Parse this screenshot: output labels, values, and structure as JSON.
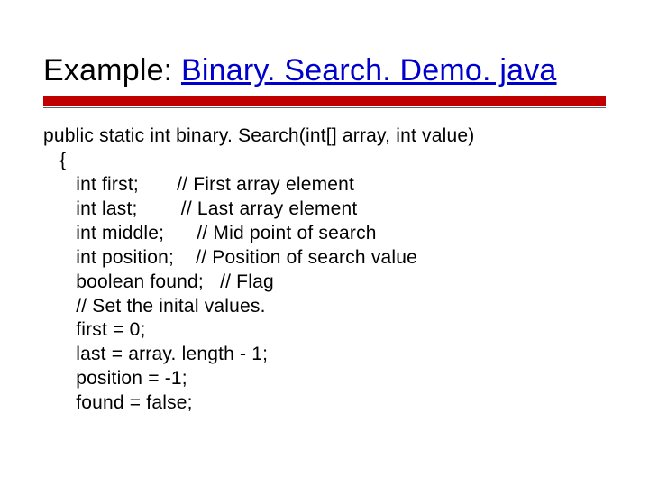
{
  "title": {
    "prefix": "Example: ",
    "link": "Binary. Search. Demo. java"
  },
  "code": "public static int binary. Search(int[] array, int value)\n   {\n      int first;       // First array element\n      int last;        // Last array element\n      int middle;      // Mid point of search\n      int position;    // Position of search value\n      boolean found;   // Flag\n      // Set the inital values.\n      first = 0;\n      last = array. length - 1;\n      position = -1;\n      found = false;"
}
